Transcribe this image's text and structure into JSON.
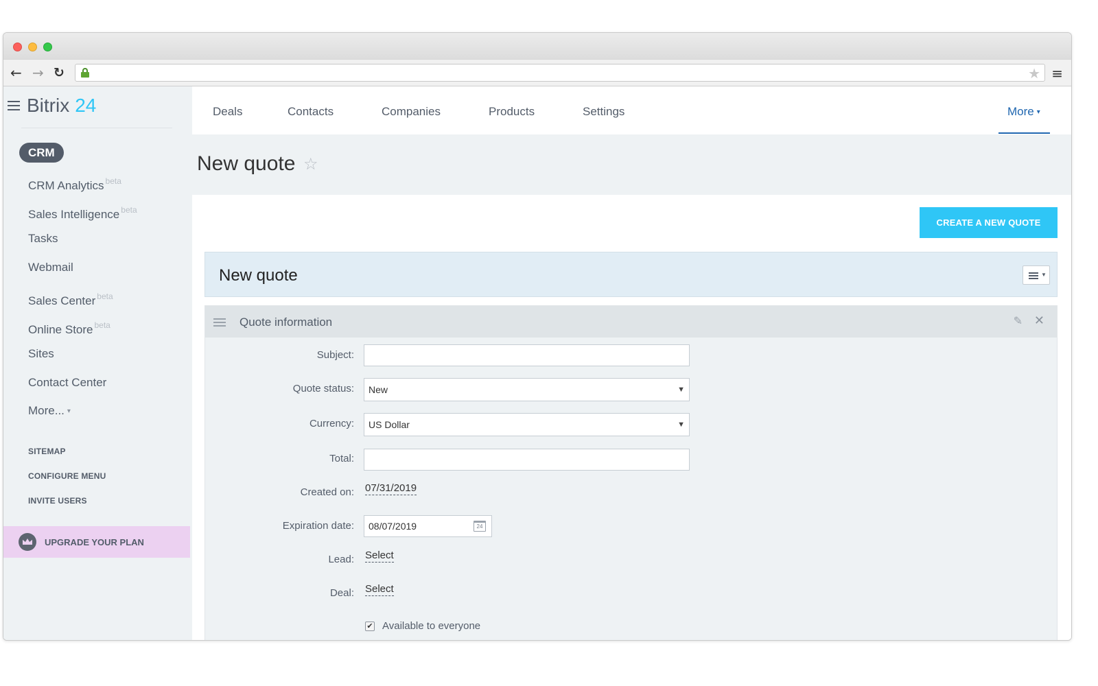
{
  "browser": {
    "back_icon": "arrow-left-icon",
    "forward_icon": "arrow-right-icon",
    "reload_icon": "reload-icon",
    "lock_icon": "lock-icon",
    "bookmark_icon": "star-icon",
    "menu_icon": "menu-icon",
    "url": ""
  },
  "logo": {
    "text": "Bitrix",
    "number": "24",
    "accent": "#2fc6f6"
  },
  "sidebar": {
    "active_pill": "CRM",
    "items": [
      {
        "label": "CRM Analytics",
        "badge": "beta"
      },
      {
        "label": "Sales Intelligence",
        "badge": "beta"
      },
      {
        "label": "Tasks",
        "badge": ""
      },
      {
        "label": "Webmail",
        "badge": ""
      },
      {
        "label": "Sales Center",
        "badge": "beta"
      },
      {
        "label": "Online Store",
        "badge": "beta"
      },
      {
        "label": "Sites",
        "badge": ""
      },
      {
        "label": "Contact Center",
        "badge": ""
      },
      {
        "label": "More...",
        "badge": ""
      }
    ],
    "links": [
      "SITEMAP",
      "CONFIGURE MENU",
      "INVITE USERS"
    ],
    "upgrade_label": "UPGRADE YOUR PLAN",
    "upgrade_bg": "#ecd1f1"
  },
  "topnav": {
    "items": [
      "Deals",
      "Contacts",
      "Companies",
      "Products",
      "Settings"
    ],
    "more_label": "More",
    "active_color": "#2067b0"
  },
  "page": {
    "title": "New quote",
    "create_button": "CREATE A NEW QUOTE",
    "panel_title": "New quote"
  },
  "section": {
    "title": "Quote information",
    "fields": {
      "subject_label": "Subject:",
      "subject_value": "",
      "status_label": "Quote status:",
      "status_value": "New",
      "currency_label": "Currency:",
      "currency_value": "US Dollar",
      "total_label": "Total:",
      "total_value": "",
      "created_label": "Created on:",
      "created_value": "07/31/2019",
      "expiration_label": "Expiration date:",
      "expiration_value": "08/07/2019",
      "calendar_day": "24",
      "lead_label": "Lead:",
      "lead_value": "Select",
      "deal_label": "Deal:",
      "deal_value": "Select",
      "available_label": "Available to everyone",
      "available_checked": true
    }
  }
}
